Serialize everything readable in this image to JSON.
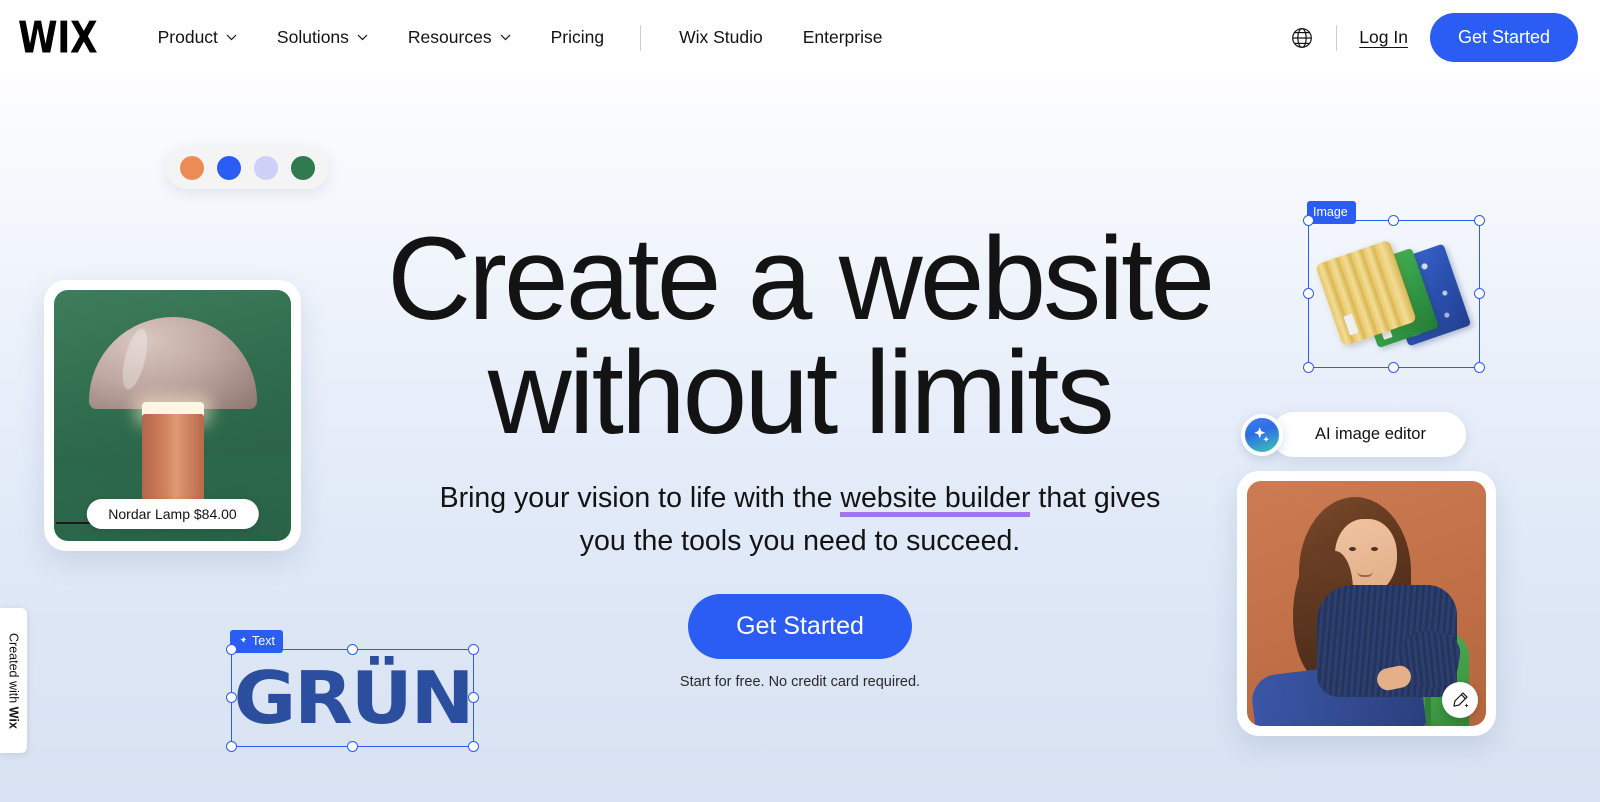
{
  "header": {
    "logo": "WIX",
    "nav": [
      {
        "label": "Product",
        "has_chevron": true
      },
      {
        "label": "Solutions",
        "has_chevron": true
      },
      {
        "label": "Resources",
        "has_chevron": true
      },
      {
        "label": "Pricing",
        "has_chevron": false
      },
      {
        "label": "Wix Studio",
        "has_chevron": false
      },
      {
        "label": "Enterprise",
        "has_chevron": false
      }
    ],
    "language_icon": "globe-icon",
    "login_label": "Log In",
    "get_started_label": "Get Started"
  },
  "hero": {
    "headline_line1": "Create a website",
    "headline_line2": "without limits",
    "subhead_prefix": "Bring your vision to life with the ",
    "subhead_highlight": "website builder",
    "subhead_suffix": " that gives you the tools you need to succeed.",
    "cta_label": "Get Started",
    "disclaimer": "Start for free. No credit card required."
  },
  "swatches": {
    "colors": [
      "#ec8b55",
      "#2b5df5",
      "#cfd0f7",
      "#2f7a4e"
    ]
  },
  "product_card": {
    "price_label": "Nordar Lamp $84.00"
  },
  "created_badge": {
    "prefix": "Created with ",
    "brand": "Wix"
  },
  "image_element": {
    "tag_label": "Image",
    "tag_icon": "none"
  },
  "text_element": {
    "tag_label": "Text",
    "tag_icon": "pin-icon",
    "content": "GRÜN"
  },
  "ai_widget": {
    "label": "AI image editor",
    "badge_icon": "sparkle-icon"
  },
  "photo_card": {
    "edit_icon": "magic-pencil-icon"
  },
  "colors": {
    "accent_blue": "#2b5df5",
    "underline_purple": "#a174f2",
    "selection_blue": "#2b5df5",
    "text_dark": "#131313",
    "bg_top": "#fdfdfe",
    "bg_bottom": "#d8e2f2"
  }
}
